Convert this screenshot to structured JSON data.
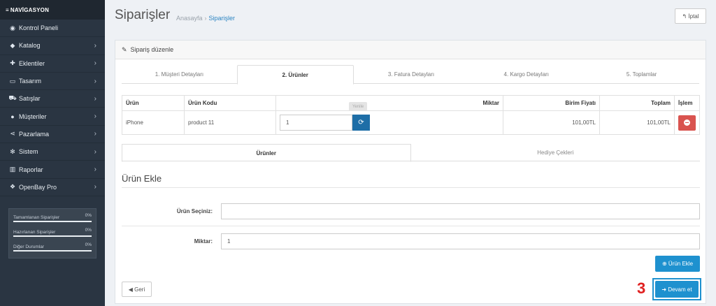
{
  "sidebar": {
    "header": "NAVİGASYON",
    "items": [
      {
        "label": "Kontrol Paneli",
        "icon": "dashboard-icon",
        "glyph": "◉",
        "has_children": false
      },
      {
        "label": "Katalog",
        "icon": "tags-icon",
        "glyph": "◆",
        "has_children": true
      },
      {
        "label": "Eklentiler",
        "icon": "puzzle-icon",
        "glyph": "✚",
        "has_children": true
      },
      {
        "label": "Tasarım",
        "icon": "monitor-icon",
        "glyph": "▭",
        "has_children": true
      },
      {
        "label": "Satışlar",
        "icon": "cart-icon",
        "glyph": "⛟",
        "has_children": true
      },
      {
        "label": "Müşteriler",
        "icon": "user-icon",
        "glyph": "●",
        "has_children": true
      },
      {
        "label": "Pazarlama",
        "icon": "share-icon",
        "glyph": "⋖",
        "has_children": true
      },
      {
        "label": "Sistem",
        "icon": "cog-icon",
        "glyph": "✻",
        "has_children": true
      },
      {
        "label": "Raporlar",
        "icon": "bar-chart-icon",
        "glyph": "▥",
        "has_children": true
      },
      {
        "label": "OpenBay Pro",
        "icon": "cubes-icon",
        "glyph": "❖",
        "has_children": true
      }
    ],
    "chevron": "›",
    "stats": [
      {
        "label": "Tamamlanan Siparişler",
        "percent": "0%"
      },
      {
        "label": "Hazırlanan Siparişler",
        "percent": "0%"
      },
      {
        "label": "Diğer Durumlar",
        "percent": "0%"
      }
    ]
  },
  "header": {
    "title": "Siparişler",
    "breadcrumb": [
      "Anasayfa",
      "Siparişler"
    ],
    "breadcrumb_sep": "›",
    "cancel_label": "↰ İptal"
  },
  "panel": {
    "title": "Sipariş düzenle",
    "title_icon": "✎",
    "steps": [
      "1. Müşteri Detayları",
      "2. Ürünler",
      "3. Fatura Detayları",
      "4. Kargo Detayları",
      "5. Toplamlar"
    ],
    "active_step": 1
  },
  "table": {
    "headers": [
      "Ürün",
      "Ürün Kodu",
      "Miktar",
      "Birim Fiyatı",
      "Toplam",
      "İşlem"
    ],
    "rows": [
      {
        "name": "iPhone",
        "code": "product 11",
        "quantity": "1",
        "unit_price": "101,00TL",
        "total": "101,00TL"
      }
    ],
    "refresh_glyph": "⟳",
    "tooltip": "Yenile"
  },
  "subtabs": [
    "Ürünler",
    "Hediye Çekleri"
  ],
  "add_product": {
    "title": "Ürün Ekle",
    "product_label": "Ürün Seçiniz:",
    "product_value": "",
    "quantity_label": "Miktar:",
    "quantity_value": "1",
    "add_button": "⊕ Ürün Ekle"
  },
  "footer": {
    "back_label": "◀ Geri",
    "next_label": "➜ Devam et",
    "annotation_number": "3"
  },
  "colors": {
    "sidebar_bg": "#2a3542",
    "primary": "#1e91cf",
    "danger": "#d9534f",
    "annotation": "#e02020"
  }
}
